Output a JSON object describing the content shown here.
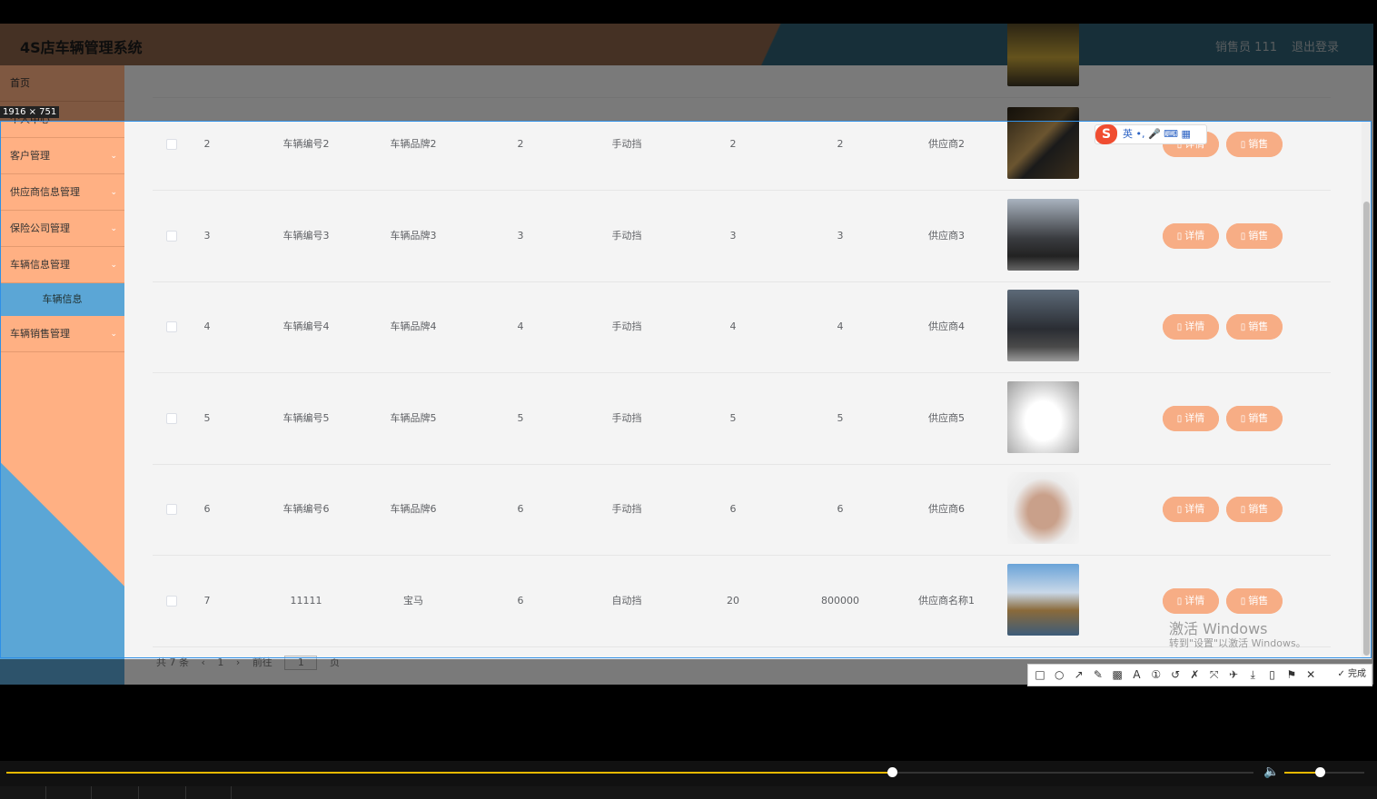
{
  "app": {
    "title": "4S店车辆管理系统",
    "user": "销售员 111",
    "logout": "退出登录"
  },
  "sidebar": {
    "items": [
      {
        "label": "首页",
        "arrow": ""
      },
      {
        "label": "个人中心",
        "arrow": ""
      },
      {
        "label": "客户管理",
        "arrow": "⌄"
      },
      {
        "label": "供应商信息管理",
        "arrow": "⌄"
      },
      {
        "label": "保险公司管理",
        "arrow": "⌄"
      },
      {
        "label": "车辆信息管理",
        "arrow": "⌄"
      }
    ],
    "sub_active": "车辆信息",
    "last_item": {
      "label": "车辆销售管理",
      "arrow": "⌄"
    }
  },
  "table": {
    "rows": [
      {
        "idx": "2",
        "code": "车辆编号2",
        "brand": "车辆品牌2",
        "c4": "2",
        "gear": "手动挡",
        "c6": "2",
        "c7": "2",
        "supplier": "供应商2",
        "photo": "car-black-sports"
      },
      {
        "idx": "3",
        "code": "车辆编号3",
        "brand": "车辆品牌3",
        "c4": "3",
        "gear": "手动挡",
        "c6": "3",
        "c7": "3",
        "supplier": "供应商3",
        "photo": "car-black-suv"
      },
      {
        "idx": "4",
        "code": "车辆编号4",
        "brand": "车辆品牌4",
        "c4": "4",
        "gear": "手动挡",
        "c6": "4",
        "c7": "4",
        "supplier": "供应商4",
        "photo": "car-dark-suv"
      },
      {
        "idx": "5",
        "code": "车辆编号5",
        "brand": "车辆品牌5",
        "c4": "5",
        "gear": "手动挡",
        "c6": "5",
        "c7": "5",
        "supplier": "供应商5",
        "photo": "car-white-roadster"
      },
      {
        "idx": "6",
        "code": "车辆编号6",
        "brand": "车辆品牌6",
        "c4": "6",
        "gear": "手动挡",
        "c6": "6",
        "c7": "6",
        "supplier": "供应商6",
        "photo": "car-bronze-coupe"
      },
      {
        "idx": "7",
        "code": "11111",
        "brand": "宝马",
        "c4": "6",
        "gear": "自动挡",
        "c6": "20",
        "c7": "800000",
        "supplier": "供应商名称1",
        "photo": "landscape-tower"
      }
    ],
    "detail_label": "详情",
    "sell_label": "销售"
  },
  "pager": {
    "total": "共 7 条",
    "prev": "‹",
    "page": "1",
    "next": "›",
    "goto": "前往",
    "goto_value": "1",
    "page_unit": "页"
  },
  "overlay": {
    "dimension_label": "1916 × 751",
    "ime_brand": "S",
    "ime_text": "英 •, 🎤 ⌨ ▦",
    "watermark_line1": "激活 Windows",
    "watermark_line2": "转到\"设置\"以激活 Windows。",
    "toolbar_done": "✓ 完成",
    "toolbar_icons": [
      "rectangle-icon",
      "ellipse-icon",
      "arrow-icon",
      "pen-icon",
      "mosaic-icon",
      "text-icon",
      "number-icon",
      "undo-icon",
      "pin-icon",
      "ocr-icon",
      "translate-icon",
      "save-icon",
      "copy-icon",
      "bookmark-icon",
      "close-icon"
    ]
  },
  "player": {
    "progress": 0.71,
    "volume": 0.44
  },
  "colors": {
    "accent": "#f7ad85",
    "sidebar": "#ffb083",
    "active": "#5ba6d6",
    "header": "#8a6348"
  }
}
